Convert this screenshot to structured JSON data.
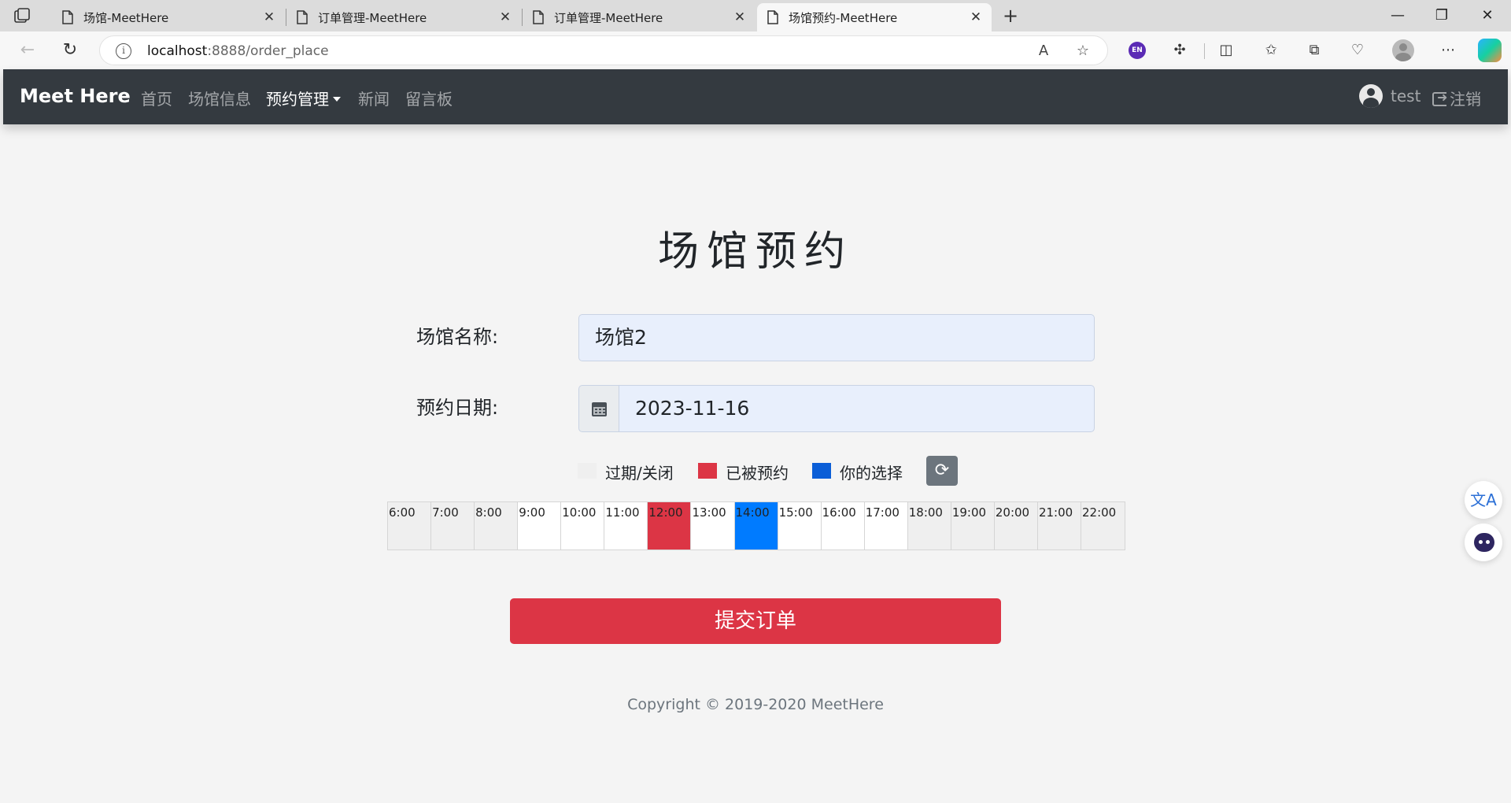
{
  "browser": {
    "tabs": [
      {
        "title": "场馆-MeetHere",
        "active": false
      },
      {
        "title": "订单管理-MeetHere",
        "active": false
      },
      {
        "title": "订单管理-MeetHere",
        "active": false
      },
      {
        "title": "场馆预约-MeetHere",
        "active": true
      }
    ],
    "url_host": "localhost",
    "url_rest": ":8888/order_place",
    "icons": [
      "tab-actions-icon",
      "page-icon",
      "close-icon",
      "plus-icon",
      "minimize-icon",
      "restore-icon",
      "close-window-icon",
      "back-icon",
      "refresh-icon",
      "info-icon",
      "read-aloud-icon",
      "star-icon",
      "extension-icon",
      "split-screen-icon",
      "favorites-icon",
      "collections-icon",
      "heart-icon",
      "profile-icon",
      "more-icon",
      "copilot-icon"
    ],
    "en_badge": "EN"
  },
  "navbar": {
    "brand": "Meet Here",
    "links": [
      "首页",
      "场馆信息",
      "预约管理",
      "新闻",
      "留言板"
    ],
    "active_link": "预约管理",
    "user": "test",
    "logout": "注销"
  },
  "page": {
    "title": "场馆预约",
    "venue_label": "场馆名称:",
    "venue_value": "场馆2",
    "date_label": "预约日期:",
    "date_value": "2023-11-16",
    "legend": [
      {
        "label": "过期/关闭",
        "color": "#efefef"
      },
      {
        "label": "已被预约",
        "color": "#dc3545"
      },
      {
        "label": "你的选择",
        "color": "#0b5ed7"
      }
    ],
    "slots": [
      {
        "time": "6:00",
        "state": "closed"
      },
      {
        "time": "7:00",
        "state": "closed"
      },
      {
        "time": "8:00",
        "state": "closed"
      },
      {
        "time": "9:00",
        "state": "free"
      },
      {
        "time": "10:00",
        "state": "free"
      },
      {
        "time": "11:00",
        "state": "free"
      },
      {
        "time": "12:00",
        "state": "booked"
      },
      {
        "time": "13:00",
        "state": "free"
      },
      {
        "time": "14:00",
        "state": "selected"
      },
      {
        "time": "15:00",
        "state": "free"
      },
      {
        "time": "16:00",
        "state": "free"
      },
      {
        "time": "17:00",
        "state": "free"
      },
      {
        "time": "18:00",
        "state": "closed"
      },
      {
        "time": "19:00",
        "state": "closed"
      },
      {
        "time": "20:00",
        "state": "closed"
      },
      {
        "time": "21:00",
        "state": "closed"
      },
      {
        "time": "22:00",
        "state": "closed"
      }
    ],
    "submit": "提交订单",
    "footer": "Copyright © 2019-2020 MeetHere"
  },
  "colors": {
    "navbar": "#343a40",
    "danger": "#dc3545",
    "primary": "#007bff",
    "secondary": "#6c757d"
  }
}
